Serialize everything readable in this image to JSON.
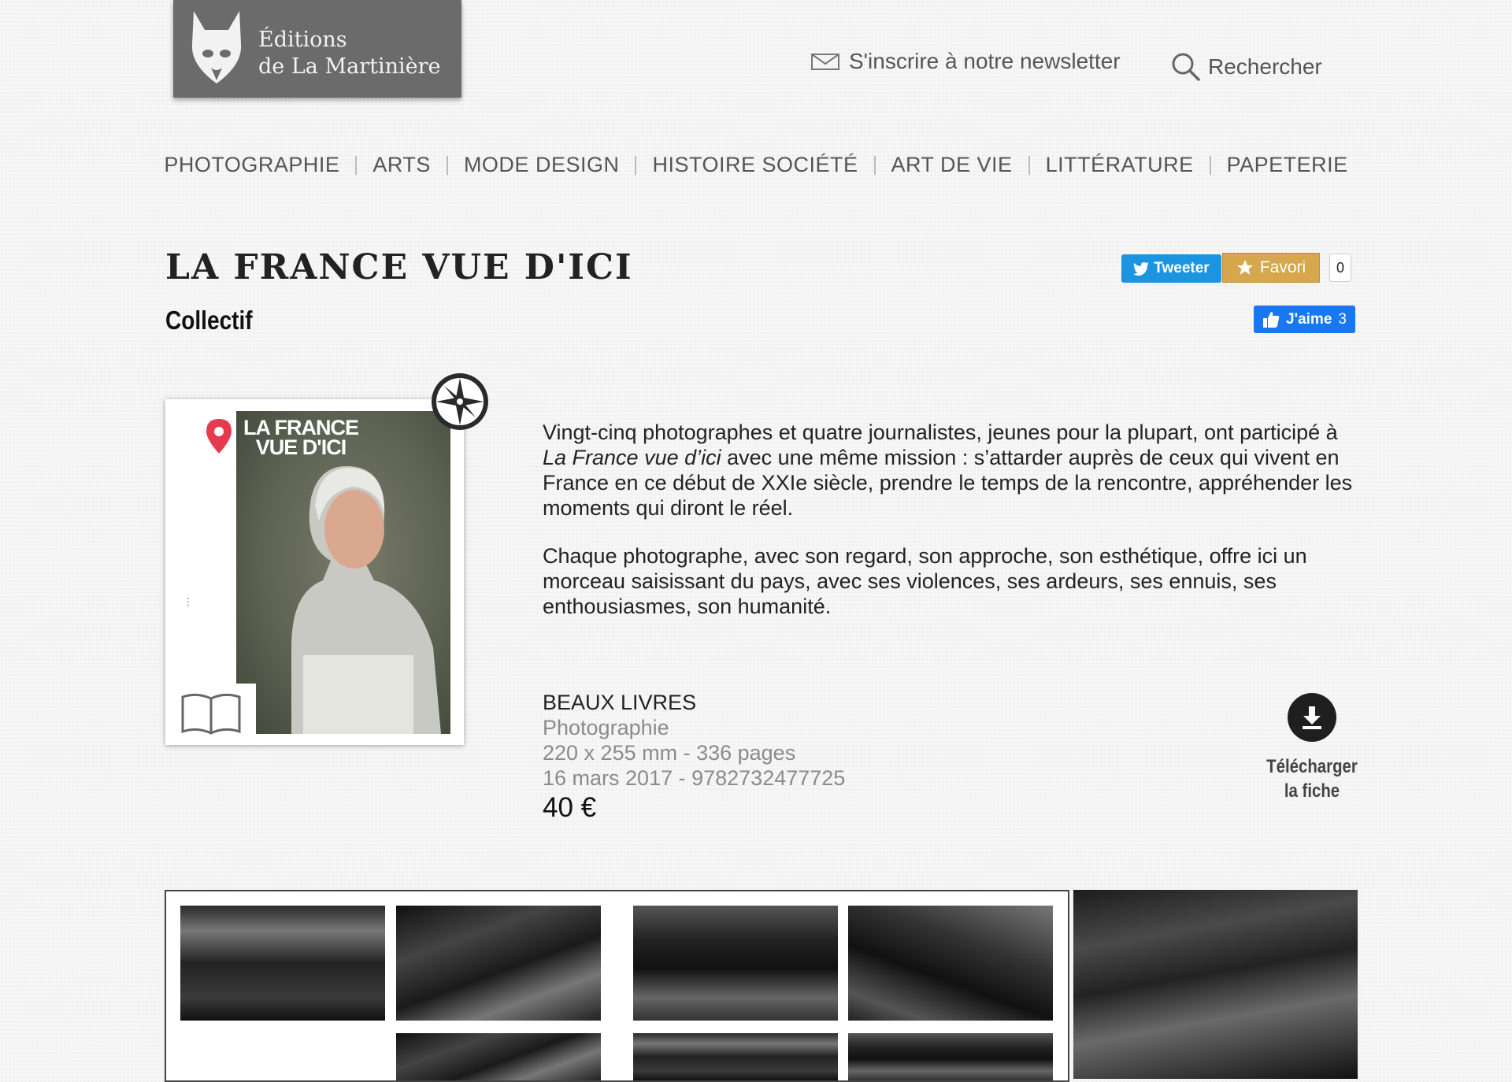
{
  "header": {
    "logo_line1": "Éditions",
    "logo_line2": "de La Martinière",
    "newsletter_label": "S'inscrire à notre newsletter",
    "search_label": "Rechercher"
  },
  "nav": {
    "items": [
      "PHOTOGRAPHIE",
      "ARTS",
      "MODE DESIGN",
      "HISTOIRE SOCIÉTÉ",
      "ART DE VIE",
      "LITTÉRATURE",
      "PAPETERIE"
    ]
  },
  "book": {
    "title": "LA FRANCE VUE D'ICI",
    "author": "Collectif",
    "cover_title_line1": "LA FRANCE",
    "cover_title_line2": "VUE D'ICI",
    "description": {
      "p1_before": "Vingt-cinq photographes et quatre journalistes, jeunes pour la plupart, ont participé à ",
      "p1_em": "La France vue d’ici",
      "p1_after": " avec une même mission : s’attarder auprès de ceux qui vivent en France en ce début de XXIe siècle, prendre le temps de la rencontre, appréhender les moments qui diront le réel.",
      "p2": "Chaque photographe, avec son regard, son approche, son esthétique, offre ici un morceau saisissant du pays, avec ses violences, ses ardeurs, ses ennuis, ses enthousiasmes, son humanité."
    },
    "collection": "BEAUX LIVRES",
    "category": "Photographie",
    "format_pages": "220 x 255 mm - 336 pages",
    "date_isbn": "16 mars 2017 - 9782732477725",
    "price": "40 €"
  },
  "social": {
    "tweet_label": "Tweeter",
    "favori_label": "Favori",
    "favori_count": "0",
    "like_label": "J'aime",
    "like_count": "3"
  },
  "download": {
    "line1": "Télécharger",
    "line2": "la fiche"
  },
  "colors": {
    "twitter": "#1b95e0",
    "favori": "#d6a74d",
    "facebook": "#1877f2",
    "pin": "#e63b4f"
  },
  "icons": {
    "newsletter": "envelope-icon",
    "search": "search-icon",
    "tweet": "twitter-bird-icon",
    "favori": "star-icon",
    "like": "thumbs-up-icon",
    "download": "download-icon",
    "preview": "open-book-icon",
    "badge": "compass-rose-icon",
    "cover_pin": "map-pin-icon"
  }
}
